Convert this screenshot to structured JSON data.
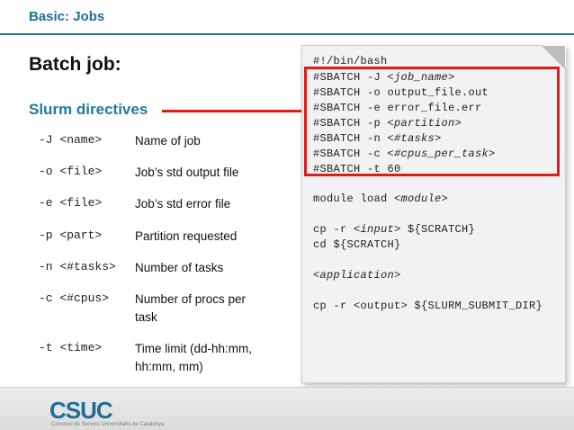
{
  "header": {
    "section_label": "Basic: Jobs"
  },
  "slide": {
    "title": "Batch job:",
    "subtitle": "Slurm directives"
  },
  "options": [
    {
      "flag": "-J <name>",
      "desc": "Name of job"
    },
    {
      "flag": "-o <file>",
      "desc": "Job’s std output file"
    },
    {
      "flag": "-e <file>",
      "desc": "Job’s std error file"
    },
    {
      "flag": "-p <part>",
      "desc": "Partition requested"
    },
    {
      "flag": "-n <#tasks>",
      "desc": "Number of tasks"
    },
    {
      "flag": "-c <#cpus>",
      "desc": "Number of procs per task"
    },
    {
      "flag": "-t <time>",
      "desc": "Time limit (dd-hh:mm, hh:mm, mm)"
    }
  ],
  "code": {
    "shebang": "#!/bin/bash",
    "sbatch": [
      {
        "prefix": "#SBATCH -J ",
        "arg": "<job_name>",
        "italic": true
      },
      {
        "prefix": "#SBATCH -o ",
        "arg": "output_file.out",
        "italic": false
      },
      {
        "prefix": "#SBATCH -e ",
        "arg": "error_file.err",
        "italic": false
      },
      {
        "prefix": "#SBATCH -p ",
        "arg": "<partition>",
        "italic": true
      },
      {
        "prefix": "#SBATCH -n ",
        "arg": "<#tasks>",
        "italic": true
      },
      {
        "prefix": "#SBATCH -c ",
        "arg": "<#cpus_per_task>",
        "italic": true
      },
      {
        "prefix": "#SBATCH -t ",
        "arg": "60",
        "italic": false
      }
    ],
    "module_prefix": "module load ",
    "module_arg": "<module>",
    "cp_in_prefix": "cp -r ",
    "cp_in_arg": "<input>",
    "cp_in_suffix": " ${SCRATCH}",
    "cd_line": "cd ${SCRATCH}",
    "application": "<application>",
    "cp_out_line": "cp -r <output> ${SLURM_SUBMIT_DIR}"
  },
  "footer": {
    "logo": "CSUC",
    "logo_sub": "Consorci de Serveis Universitaris de Catalunya"
  },
  "colors": {
    "accent": "#1f6f94",
    "highlight": "#e01b1b"
  }
}
